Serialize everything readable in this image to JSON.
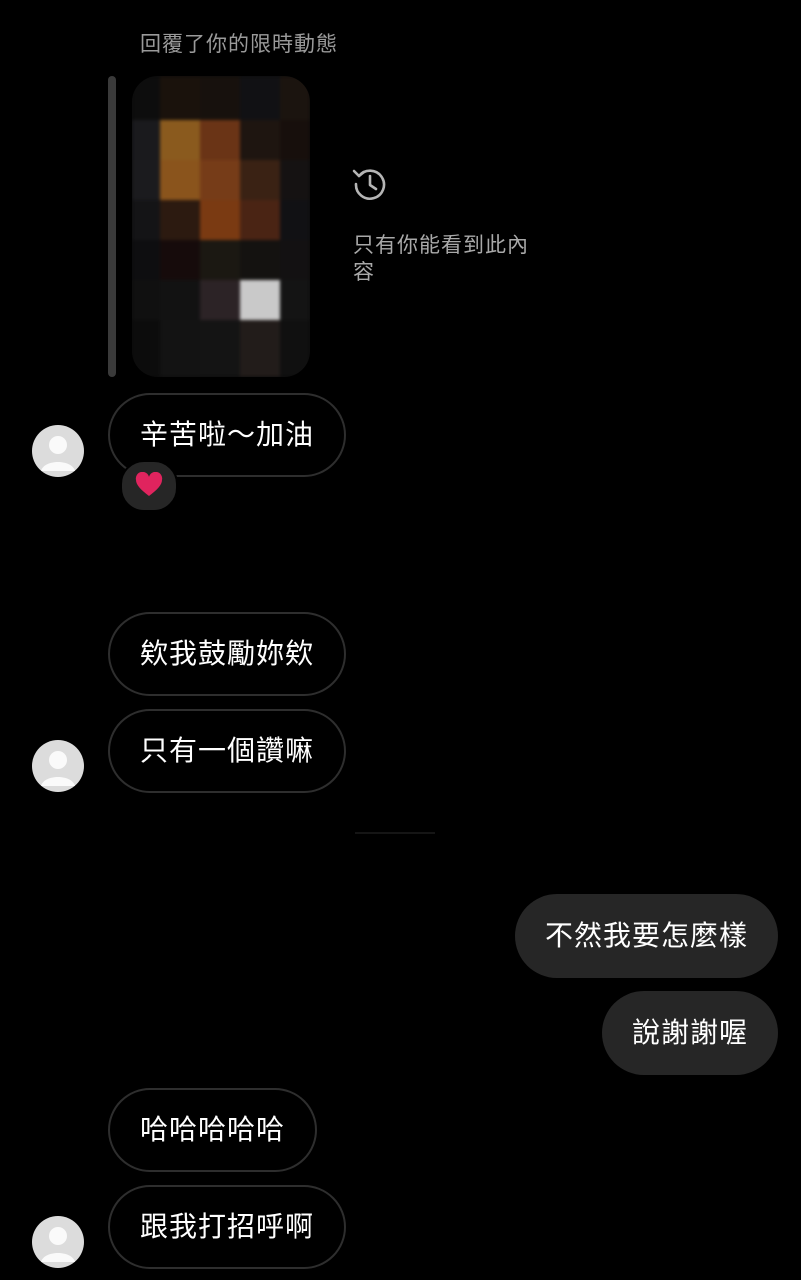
{
  "story_reply": {
    "label": "回覆了你的限時動態",
    "private_note": "只有你能看到此內容"
  },
  "icons": {
    "history": "history-icon",
    "reaction": "red-heart-icon",
    "avatar": "default-avatar-icon"
  },
  "messages": [
    {
      "id": 1,
      "direction": "incoming",
      "text": "辛苦啦～加油",
      "reaction": "❤️"
    },
    {
      "id": 2,
      "direction": "incoming",
      "text": "欸我鼓勵妳欸"
    },
    {
      "id": 3,
      "direction": "incoming",
      "text": "只有一個讚嘛"
    },
    {
      "id": 4,
      "direction": "outgoing",
      "text": "不然我要怎麼樣"
    },
    {
      "id": 5,
      "direction": "outgoing",
      "text": "說謝謝喔"
    },
    {
      "id": 6,
      "direction": "incoming",
      "text": "哈哈哈哈哈"
    },
    {
      "id": 7,
      "direction": "incoming",
      "text": "跟我打招呼啊"
    }
  ],
  "colors": {
    "background": "#000000",
    "outgoing_bubble": "#262626",
    "incoming_border": "#2e2e2e",
    "reaction_heart": "#e0245e"
  }
}
